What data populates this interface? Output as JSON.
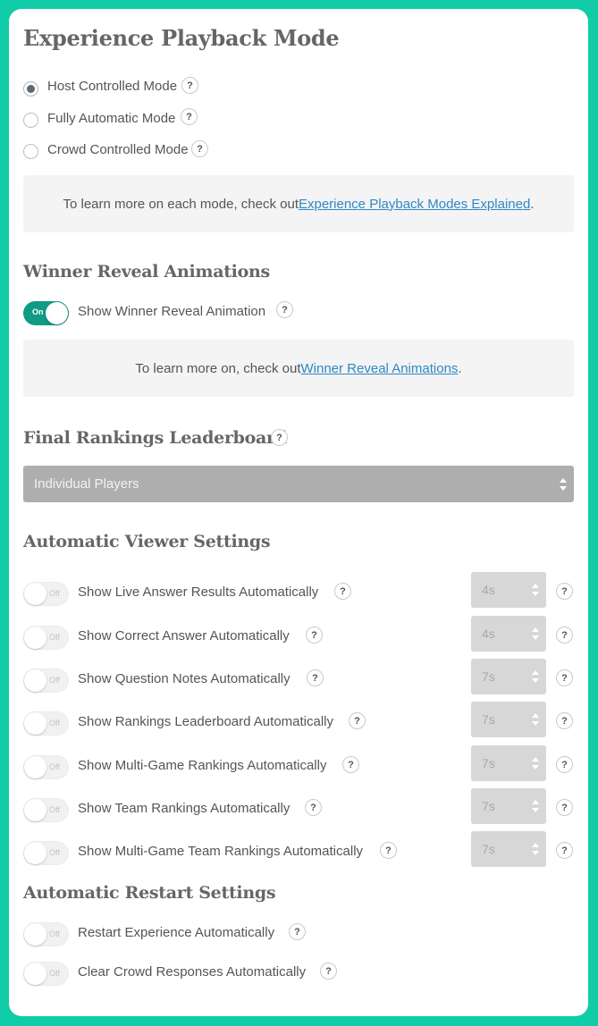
{
  "title": "Experience Playback Mode",
  "playback_modes": [
    {
      "label": "Host Controlled Mode",
      "checked": true
    },
    {
      "label": "Fully Automatic Mode",
      "checked": false
    },
    {
      "label": "Crowd Controlled Mode",
      "checked": false
    }
  ],
  "playback_info": {
    "prefix": "To learn more on each mode, check out ",
    "link": "Experience Playback Modes Explained",
    "suffix": "."
  },
  "winner_reveal": {
    "heading": "Winner Reveal Animations",
    "toggle_text": "On",
    "toggle_label": "Show Winner Reveal Animation",
    "info_prefix": "To learn more on, check out ",
    "info_link": "Winner Reveal Animations",
    "info_suffix": "."
  },
  "final_rankings": {
    "heading": "Final Rankings Leaderboard",
    "selected": "Individual Players"
  },
  "viewer_settings": {
    "heading": "Automatic Viewer Settings",
    "off_text": "Off",
    "items": [
      {
        "label": "Show Live Answer Results Automatically",
        "value": "4s"
      },
      {
        "label": "Show Correct Answer Automatically",
        "value": "4s"
      },
      {
        "label": "Show Question Notes Automatically",
        "value": "7s"
      },
      {
        "label": "Show Rankings Leaderboard Automatically",
        "value": "7s"
      },
      {
        "label": "Show Multi-Game Rankings Automatically",
        "value": "7s"
      },
      {
        "label": "Show Team Rankings Automatically",
        "value": "7s"
      },
      {
        "label": "Show Multi-Game Team Rankings Automatically",
        "value": "7s"
      }
    ]
  },
  "restart_settings": {
    "heading": "Automatic Restart Settings",
    "off_text": "Off",
    "items": [
      {
        "label": "Restart Experience Automatically"
      },
      {
        "label": "Clear Crowd Responses Automatically"
      }
    ]
  },
  "help_glyph": "?",
  "colors": {
    "background": "#10cca8",
    "toggle_on": "#0f9b84",
    "link": "#2f88c4"
  }
}
